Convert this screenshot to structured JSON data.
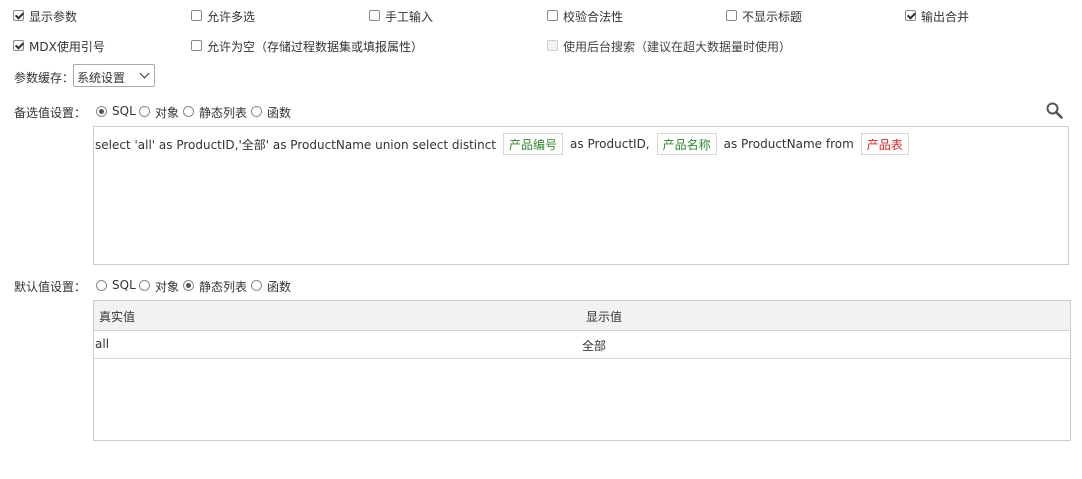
{
  "options": {
    "show_params": {
      "label": "显示参数",
      "checked": true
    },
    "allow_multi": {
      "label": "允许多选",
      "checked": false
    },
    "manual_input": {
      "label": "手工输入",
      "checked": false
    },
    "validate": {
      "label": "校验合法性",
      "checked": false
    },
    "hide_title": {
      "label": "不显示标题",
      "checked": false
    },
    "merge_output": {
      "label": "输出合并",
      "checked": true
    },
    "mdx_ref": {
      "label": "MDX使用引号",
      "checked": true
    },
    "allow_empty": {
      "label": "允许为空（存储过程数据集或填报属性）",
      "checked": false
    },
    "backend_search": {
      "label": "使用后台搜索（建议在超大数据量时使用）",
      "checked": false,
      "disabled": true
    }
  },
  "cache": {
    "label": "参数缓存：",
    "selected": "系统设置"
  },
  "candidate": {
    "label": "备选值设置：",
    "radios": [
      "SQL",
      "对象",
      "静态列表",
      "函数"
    ],
    "selected": "SQL",
    "sql": {
      "part1": "select 'all' as ProductID,'全部' as ProductName union select distinct",
      "token1": "产品编号",
      "part2": "as ProductID,",
      "token2": "产品名称",
      "part3": "as ProductName from",
      "token3": "产品表"
    },
    "search_icon": "search-icon"
  },
  "default": {
    "label": "默认值设置：",
    "radios": [
      "SQL",
      "对象",
      "静态列表",
      "函数"
    ],
    "selected": "静态列表",
    "table": {
      "headers": [
        "真实值",
        "显示值"
      ],
      "rows": [
        [
          "all",
          "全部"
        ]
      ]
    }
  },
  "colors": {
    "token_green": "#2f8a2f",
    "token_red": "#d62828"
  }
}
